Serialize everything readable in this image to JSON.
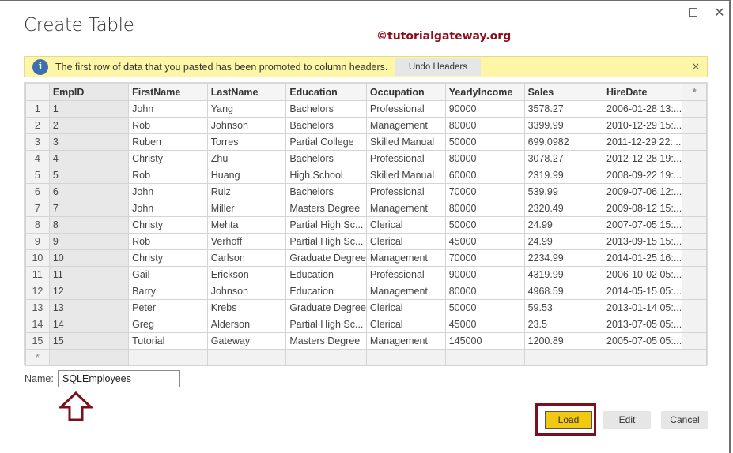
{
  "dialog": {
    "title": "Create Table",
    "watermark": "©tutorialgateway.org",
    "maximize_icon": "maximize-icon",
    "close_icon": "close-icon",
    "close_glyph": "✕"
  },
  "banner": {
    "icon": "info-icon",
    "icon_glyph": "i",
    "message": "The first row of data that you pasted has been promoted to column headers.",
    "undo_label": "Undo Headers",
    "dismiss_glyph": "×"
  },
  "grid": {
    "columns": [
      "EmpID",
      "FirstName",
      "LastName",
      "Education",
      "Occupation",
      "YearlyIncome",
      "Sales",
      "HireDate"
    ],
    "add_column_glyph": "*",
    "new_row_glyph": "*",
    "rows": [
      {
        "n": "1",
        "cells": [
          "1",
          "John",
          "Yang",
          "Bachelors",
          "Professional",
          "90000",
          "3578.27",
          "2006-01-28 13:..."
        ]
      },
      {
        "n": "2",
        "cells": [
          "2",
          "Rob",
          "Johnson",
          "Bachelors",
          "Management",
          "80000",
          "3399.99",
          "2010-12-29 15:..."
        ]
      },
      {
        "n": "3",
        "cells": [
          "3",
          "Ruben",
          "Torres",
          "Partial College",
          "Skilled Manual",
          "50000",
          "699.0982",
          "2011-12-29 22:..."
        ]
      },
      {
        "n": "4",
        "cells": [
          "4",
          "Christy",
          "Zhu",
          "Bachelors",
          "Professional",
          "80000",
          "3078.27",
          "2012-12-28 19:..."
        ]
      },
      {
        "n": "5",
        "cells": [
          "5",
          "Rob",
          "Huang",
          "High School",
          "Skilled Manual",
          "60000",
          "2319.99",
          "2008-09-22 19:..."
        ]
      },
      {
        "n": "6",
        "cells": [
          "6",
          "John",
          "Ruiz",
          "Bachelors",
          "Professional",
          "70000",
          "539.99",
          "2009-07-06 12:..."
        ]
      },
      {
        "n": "7",
        "cells": [
          "7",
          "John",
          "Miller",
          "Masters Degree",
          "Management",
          "80000",
          "2320.49",
          "2009-08-12 15:..."
        ]
      },
      {
        "n": "8",
        "cells": [
          "8",
          "Christy",
          "Mehta",
          "Partial High Sc...",
          "Clerical",
          "50000",
          "24.99",
          "2007-07-05 15:..."
        ]
      },
      {
        "n": "9",
        "cells": [
          "9",
          "Rob",
          "Verhoff",
          "Partial High Sc...",
          "Clerical",
          "45000",
          "24.99",
          "2013-09-15 15:..."
        ]
      },
      {
        "n": "10",
        "cells": [
          "10",
          "Christy",
          "Carlson",
          "Graduate Degree",
          "Management",
          "70000",
          "2234.99",
          "2014-01-25 16:..."
        ]
      },
      {
        "n": "11",
        "cells": [
          "11",
          "Gail",
          "Erickson",
          "Education",
          "Professional",
          "90000",
          "4319.99",
          "2006-10-02 05:..."
        ]
      },
      {
        "n": "12",
        "cells": [
          "12",
          "Barry",
          "Johnson",
          "Education",
          "Management",
          "80000",
          "4968.59",
          "2014-05-15 05:..."
        ]
      },
      {
        "n": "13",
        "cells": [
          "13",
          "Peter",
          "Krebs",
          "Graduate Degree",
          "Clerical",
          "50000",
          "59.53",
          "2013-01-14 05:..."
        ]
      },
      {
        "n": "14",
        "cells": [
          "14",
          "Greg",
          "Alderson",
          "Partial High Sc...",
          "Clerical",
          "45000",
          "23.5",
          "2013-07-05 05:..."
        ]
      },
      {
        "n": "15",
        "cells": [
          "15",
          "Tutorial",
          "Gateway",
          "Masters Degree",
          "Management",
          "145000",
          "1200.89",
          "2005-07-05 05:..."
        ]
      }
    ]
  },
  "name_field": {
    "label": "Name:",
    "value": "SQLEmployees"
  },
  "annotation": {
    "arrow_icon": "up-arrow-icon",
    "highlight_color": "#7a0f1d"
  },
  "buttons": {
    "load": "Load",
    "edit": "Edit",
    "cancel": "Cancel"
  },
  "colors": {
    "accent_load": "#f2c811",
    "banner_bg": "#fdf6a6",
    "watermark": "#8b0d1a",
    "info_icon": "#3d6fb0"
  }
}
